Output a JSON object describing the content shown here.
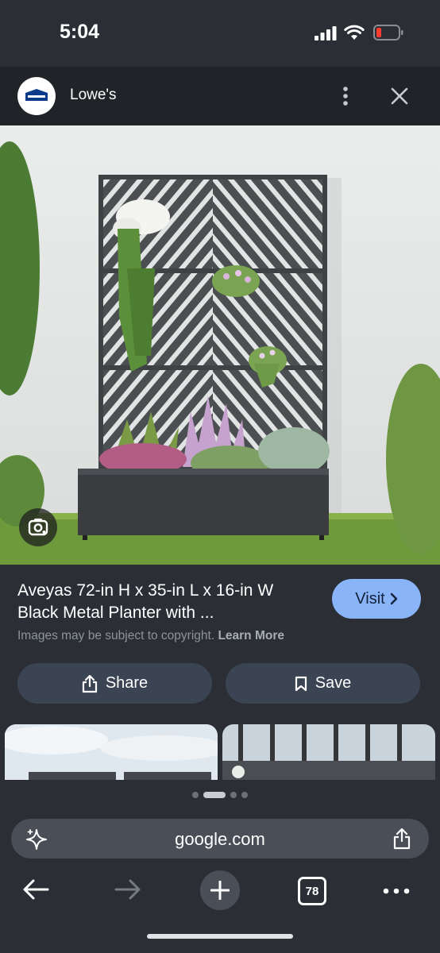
{
  "status_bar": {
    "time": "5:04"
  },
  "header": {
    "source_name": "Lowe's"
  },
  "product": {
    "title_line1": "Aveyas 72-in H x 35-in L x 16-in W",
    "title_line2": "Black Metal Planter with ...",
    "visit_label": "Visit"
  },
  "copyright": {
    "text": "Images may be subject to copyright.",
    "link": "Learn More"
  },
  "actions": {
    "share_label": "Share",
    "save_label": "Save"
  },
  "browser": {
    "url": "google.com",
    "tab_count": "78"
  },
  "colors": {
    "accent": "#8ab4f8",
    "button_bg": "#3a4452",
    "background": "#2b2f35"
  }
}
